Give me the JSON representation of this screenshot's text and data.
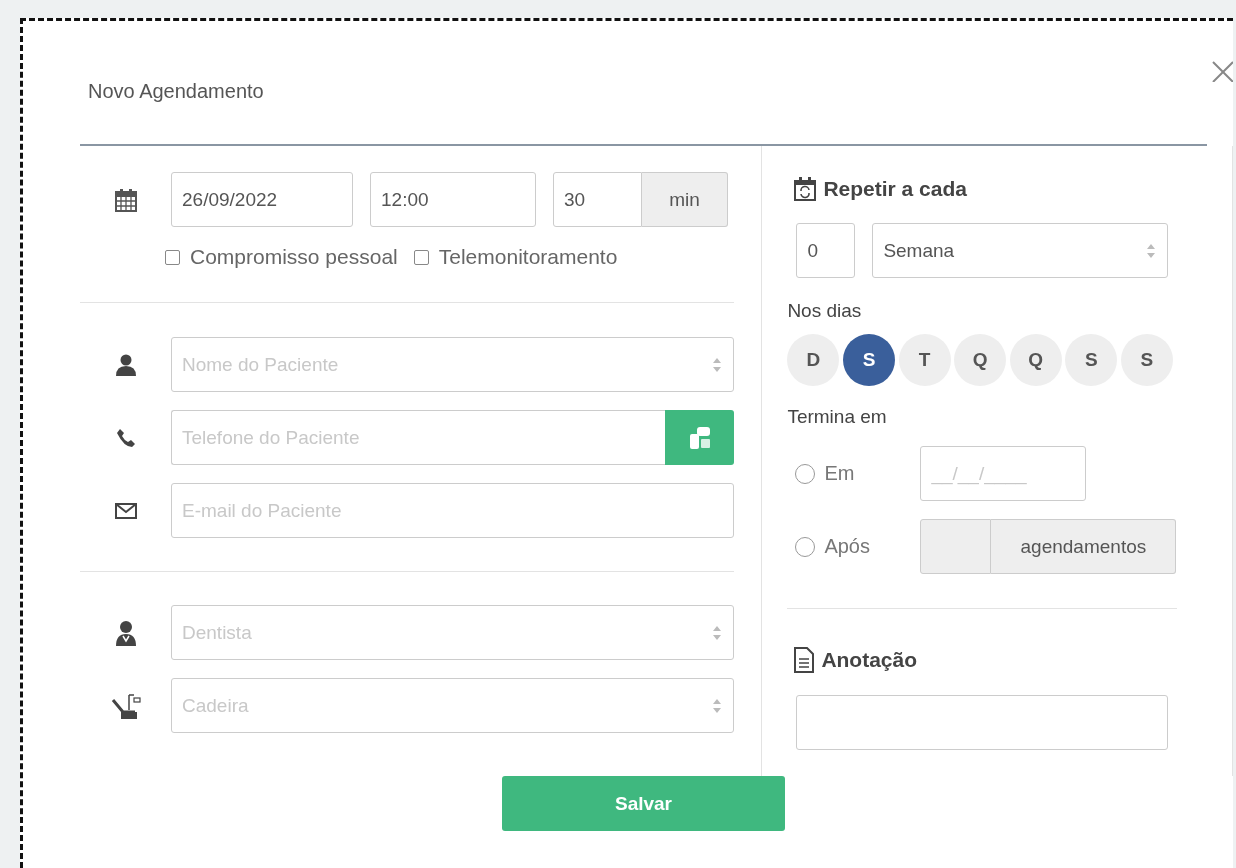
{
  "dialog": {
    "title": "Novo Agendamento"
  },
  "schedule": {
    "date": "26/09/2022",
    "time": "12:00",
    "duration": "30",
    "duration_unit": "min"
  },
  "checkboxes": [
    {
      "label": "Compromisso pessoal",
      "checked": false
    },
    {
      "label": "Telemonitoramento",
      "checked": false
    }
  ],
  "patient_fields": [
    {
      "kind": "select",
      "placeholder": "Nome do Paciente"
    },
    {
      "kind": "phone",
      "placeholder": "Telefone do Paciente"
    },
    {
      "kind": "text",
      "placeholder": "E-mail do Paciente"
    }
  ],
  "staff_fields": [
    {
      "kind": "select",
      "placeholder": "Dentista"
    },
    {
      "kind": "select",
      "placeholder": "Cadeira"
    }
  ],
  "repeat": {
    "title": "Repetir a cada",
    "count": "0",
    "period": "Semana",
    "days_label": "Nos dias",
    "days": [
      {
        "label": "D",
        "selected": false
      },
      {
        "label": "S",
        "selected": true
      },
      {
        "label": "T",
        "selected": false
      },
      {
        "label": "Q",
        "selected": false
      },
      {
        "label": "Q",
        "selected": false
      },
      {
        "label": "S",
        "selected": false
      },
      {
        "label": "S",
        "selected": false
      }
    ],
    "ends_label": "Termina em",
    "end_options": [
      {
        "kind": "date",
        "label": "Em",
        "placeholder": "__/__/____",
        "selected": false
      },
      {
        "kind": "count",
        "label": "Após",
        "unit": "agendamentos",
        "selected": false
      }
    ]
  },
  "note": {
    "title": "Anotação"
  },
  "save_button": "Salvar"
}
